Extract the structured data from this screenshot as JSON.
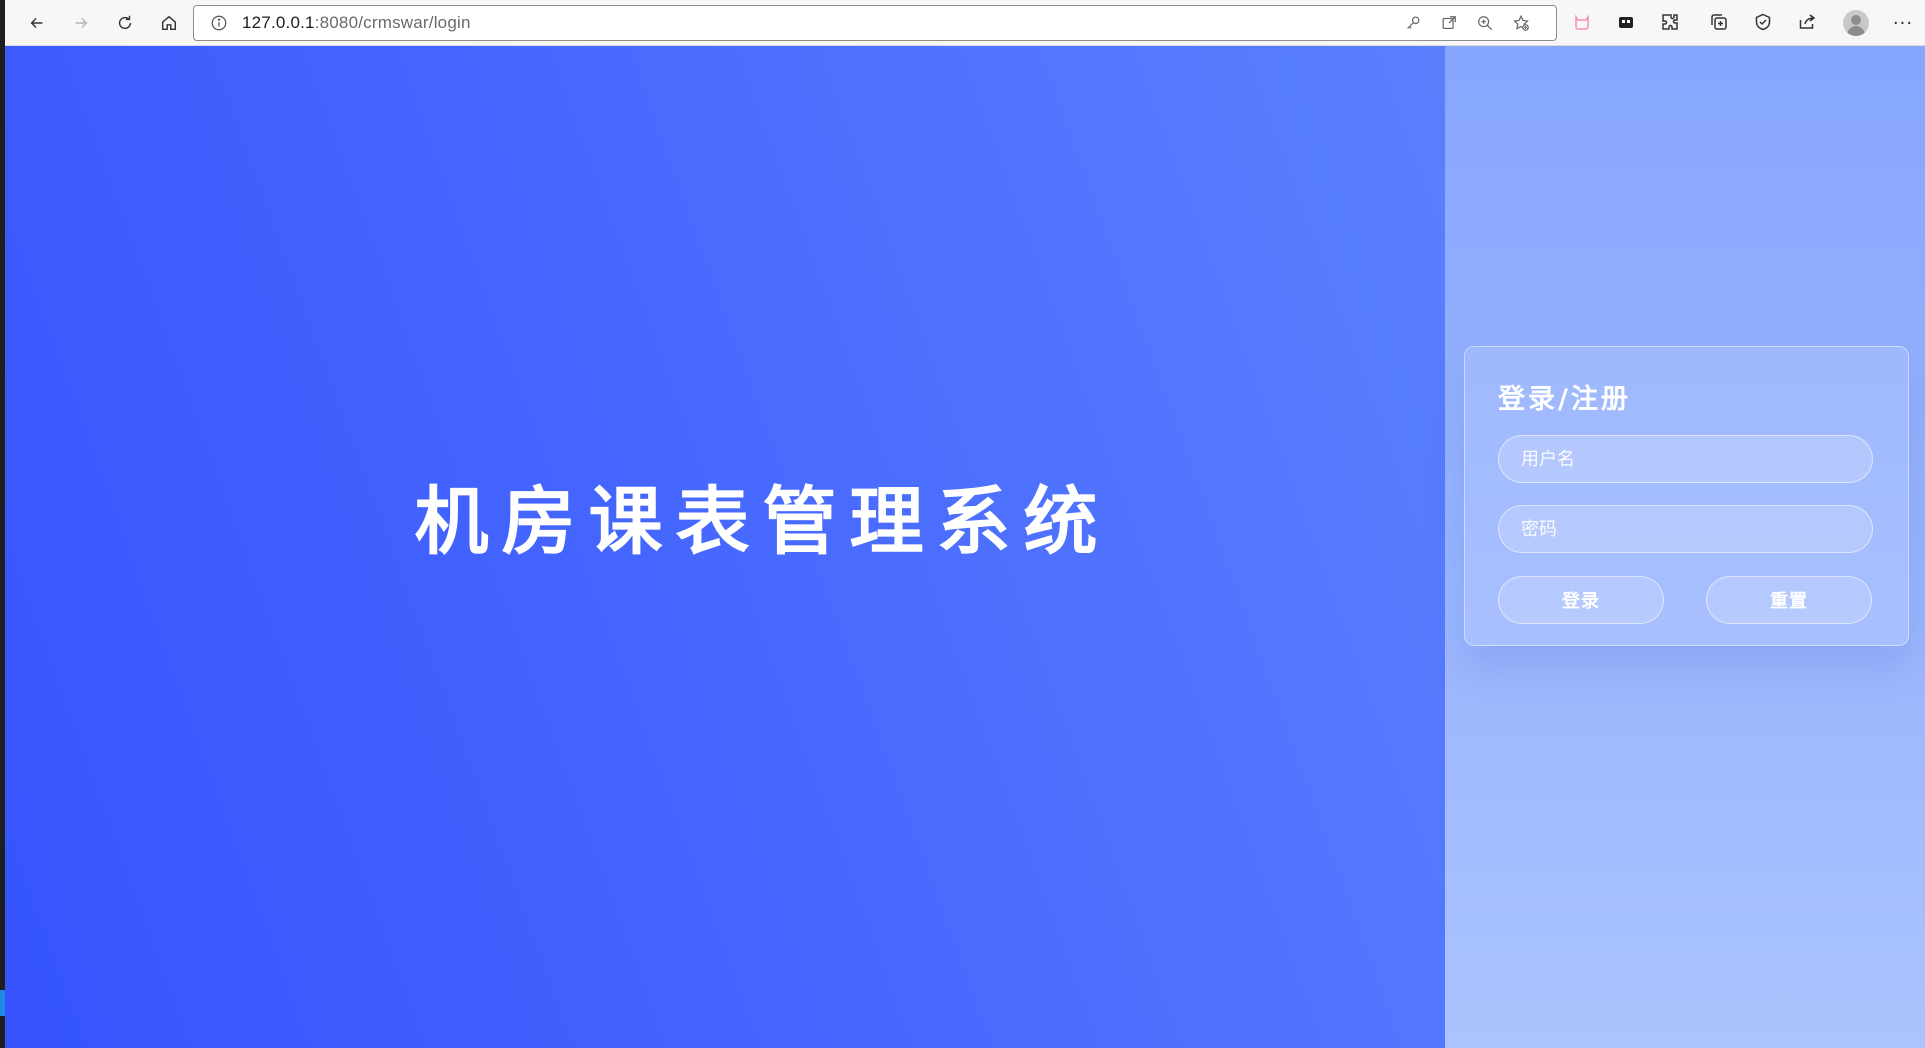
{
  "browser": {
    "url_host": "127.0.0.1",
    "url_path": ":8080/crmswar/login"
  },
  "page": {
    "hero_title": "机房课表管理系统",
    "login_card": {
      "title": "登录/注册",
      "username_placeholder": "用户名",
      "password_placeholder": "密码",
      "login_button": "登录",
      "reset_button": "重置"
    }
  },
  "colors": {
    "hero_gradient_start": "#3554fd",
    "hero_gradient_end": "#5a80fe",
    "side_panel": "#9ab5fe",
    "text_white": "#ffffff"
  }
}
